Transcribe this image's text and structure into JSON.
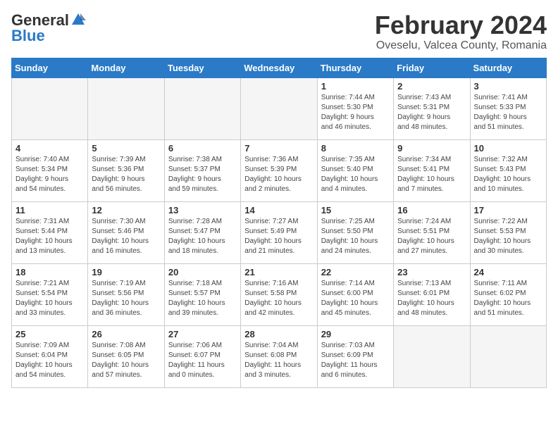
{
  "header": {
    "logo_general": "General",
    "logo_blue": "Blue",
    "month": "February 2024",
    "location": "Oveselu, Valcea County, Romania"
  },
  "weekdays": [
    "Sunday",
    "Monday",
    "Tuesday",
    "Wednesday",
    "Thursday",
    "Friday",
    "Saturday"
  ],
  "weeks": [
    [
      {
        "day": "",
        "info": ""
      },
      {
        "day": "",
        "info": ""
      },
      {
        "day": "",
        "info": ""
      },
      {
        "day": "",
        "info": ""
      },
      {
        "day": "1",
        "info": "Sunrise: 7:44 AM\nSunset: 5:30 PM\nDaylight: 9 hours\nand 46 minutes."
      },
      {
        "day": "2",
        "info": "Sunrise: 7:43 AM\nSunset: 5:31 PM\nDaylight: 9 hours\nand 48 minutes."
      },
      {
        "day": "3",
        "info": "Sunrise: 7:41 AM\nSunset: 5:33 PM\nDaylight: 9 hours\nand 51 minutes."
      }
    ],
    [
      {
        "day": "4",
        "info": "Sunrise: 7:40 AM\nSunset: 5:34 PM\nDaylight: 9 hours\nand 54 minutes."
      },
      {
        "day": "5",
        "info": "Sunrise: 7:39 AM\nSunset: 5:36 PM\nDaylight: 9 hours\nand 56 minutes."
      },
      {
        "day": "6",
        "info": "Sunrise: 7:38 AM\nSunset: 5:37 PM\nDaylight: 9 hours\nand 59 minutes."
      },
      {
        "day": "7",
        "info": "Sunrise: 7:36 AM\nSunset: 5:39 PM\nDaylight: 10 hours\nand 2 minutes."
      },
      {
        "day": "8",
        "info": "Sunrise: 7:35 AM\nSunset: 5:40 PM\nDaylight: 10 hours\nand 4 minutes."
      },
      {
        "day": "9",
        "info": "Sunrise: 7:34 AM\nSunset: 5:41 PM\nDaylight: 10 hours\nand 7 minutes."
      },
      {
        "day": "10",
        "info": "Sunrise: 7:32 AM\nSunset: 5:43 PM\nDaylight: 10 hours\nand 10 minutes."
      }
    ],
    [
      {
        "day": "11",
        "info": "Sunrise: 7:31 AM\nSunset: 5:44 PM\nDaylight: 10 hours\nand 13 minutes."
      },
      {
        "day": "12",
        "info": "Sunrise: 7:30 AM\nSunset: 5:46 PM\nDaylight: 10 hours\nand 16 minutes."
      },
      {
        "day": "13",
        "info": "Sunrise: 7:28 AM\nSunset: 5:47 PM\nDaylight: 10 hours\nand 18 minutes."
      },
      {
        "day": "14",
        "info": "Sunrise: 7:27 AM\nSunset: 5:49 PM\nDaylight: 10 hours\nand 21 minutes."
      },
      {
        "day": "15",
        "info": "Sunrise: 7:25 AM\nSunset: 5:50 PM\nDaylight: 10 hours\nand 24 minutes."
      },
      {
        "day": "16",
        "info": "Sunrise: 7:24 AM\nSunset: 5:51 PM\nDaylight: 10 hours\nand 27 minutes."
      },
      {
        "day": "17",
        "info": "Sunrise: 7:22 AM\nSunset: 5:53 PM\nDaylight: 10 hours\nand 30 minutes."
      }
    ],
    [
      {
        "day": "18",
        "info": "Sunrise: 7:21 AM\nSunset: 5:54 PM\nDaylight: 10 hours\nand 33 minutes."
      },
      {
        "day": "19",
        "info": "Sunrise: 7:19 AM\nSunset: 5:56 PM\nDaylight: 10 hours\nand 36 minutes."
      },
      {
        "day": "20",
        "info": "Sunrise: 7:18 AM\nSunset: 5:57 PM\nDaylight: 10 hours\nand 39 minutes."
      },
      {
        "day": "21",
        "info": "Sunrise: 7:16 AM\nSunset: 5:58 PM\nDaylight: 10 hours\nand 42 minutes."
      },
      {
        "day": "22",
        "info": "Sunrise: 7:14 AM\nSunset: 6:00 PM\nDaylight: 10 hours\nand 45 minutes."
      },
      {
        "day": "23",
        "info": "Sunrise: 7:13 AM\nSunset: 6:01 PM\nDaylight: 10 hours\nand 48 minutes."
      },
      {
        "day": "24",
        "info": "Sunrise: 7:11 AM\nSunset: 6:02 PM\nDaylight: 10 hours\nand 51 minutes."
      }
    ],
    [
      {
        "day": "25",
        "info": "Sunrise: 7:09 AM\nSunset: 6:04 PM\nDaylight: 10 hours\nand 54 minutes."
      },
      {
        "day": "26",
        "info": "Sunrise: 7:08 AM\nSunset: 6:05 PM\nDaylight: 10 hours\nand 57 minutes."
      },
      {
        "day": "27",
        "info": "Sunrise: 7:06 AM\nSunset: 6:07 PM\nDaylight: 11 hours\nand 0 minutes."
      },
      {
        "day": "28",
        "info": "Sunrise: 7:04 AM\nSunset: 6:08 PM\nDaylight: 11 hours\nand 3 minutes."
      },
      {
        "day": "29",
        "info": "Sunrise: 7:03 AM\nSunset: 6:09 PM\nDaylight: 11 hours\nand 6 minutes."
      },
      {
        "day": "",
        "info": ""
      },
      {
        "day": "",
        "info": ""
      }
    ]
  ]
}
